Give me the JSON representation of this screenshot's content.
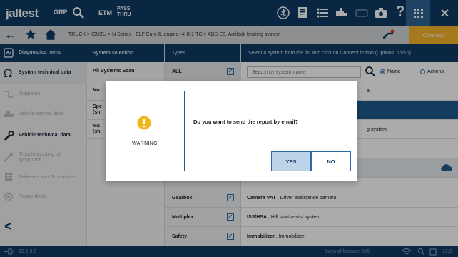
{
  "colors": {
    "primary_dark": "#0e3a63",
    "accent": "#f6b72c",
    "selection": "#1e5a8c",
    "warning": "#f2b51c"
  },
  "topbar": {
    "logo": "jaltest",
    "logo_sub": "GRP",
    "etm_label": "ETM",
    "pass_thru_line1": "PASS",
    "pass_thru_line2": "THRU",
    "icons": [
      "magnifier-icon",
      "bluetooth-icon",
      "report-icon",
      "list-icon",
      "truck-icon",
      "battery-icon",
      "camera-icon",
      "help-icon",
      "apps-icon"
    ],
    "help_label": "?"
  },
  "breadcrumb": {
    "path": "TRUCK > ISUZU > N Series - ELF Euro 6, engine: 4HK1-TC > ABS-E8, Antilock braking system"
  },
  "connect_label": "Connect",
  "sidebar": {
    "items": [
      {
        "label": "Diagnostics menu",
        "icon": "diagnostics-icon"
      },
      {
        "label": "System technical data",
        "icon": "omega-icon"
      },
      {
        "label": "Diagrams",
        "icon": "diagram-icon"
      },
      {
        "label": "Vehicle service data",
        "icon": "service-icon"
      },
      {
        "label": "Vehicle technical data",
        "icon": "wrench-icon"
      },
      {
        "label": "Troubleshooting by symptoms",
        "icon": "troubleshooting-icon"
      },
      {
        "label": "Releases and Procedures",
        "icon": "procedures-icon"
      },
      {
        "label": "Repair times",
        "icon": "repair-times-icon"
      }
    ]
  },
  "systems": {
    "header": "System selection",
    "rows": [
      {
        "label": "All Systems Scan"
      },
      {
        "label": "Ma"
      },
      {
        "label": "Spe\n(sh"
      },
      {
        "label": "Ma\n(sh"
      }
    ]
  },
  "types": {
    "header": "Types",
    "rows": [
      {
        "label": "ALL",
        "checked": true
      },
      {
        "label": "Gearbox",
        "checked": true
      },
      {
        "label": "Multiplex",
        "checked": true
      },
      {
        "label": "Safety",
        "checked": true
      }
    ]
  },
  "main": {
    "header": "Select a system from the list and click on Connect button (Options: 15/15)",
    "search_placeholder": "Search by system name",
    "radio_name": "Name",
    "radio_actions": "Actions",
    "partial_rows": [
      "al",
      "g system"
    ],
    "rows": [
      {
        "code": "Camera VAT",
        "desc": "Driver assistance camera"
      },
      {
        "code": "ISS/HSA",
        "desc": "Hill start assist system"
      },
      {
        "code": "Immobilizer",
        "desc": "Immobilizer"
      }
    ]
  },
  "statusbar": {
    "version": "20.1.0.0",
    "licence": "Days of licence: 305",
    "time": "12:2"
  },
  "dialog": {
    "type_label": "WARNING",
    "question": "Do you want to send the report by email?",
    "yes_label": "YES",
    "no_label": "NO"
  }
}
